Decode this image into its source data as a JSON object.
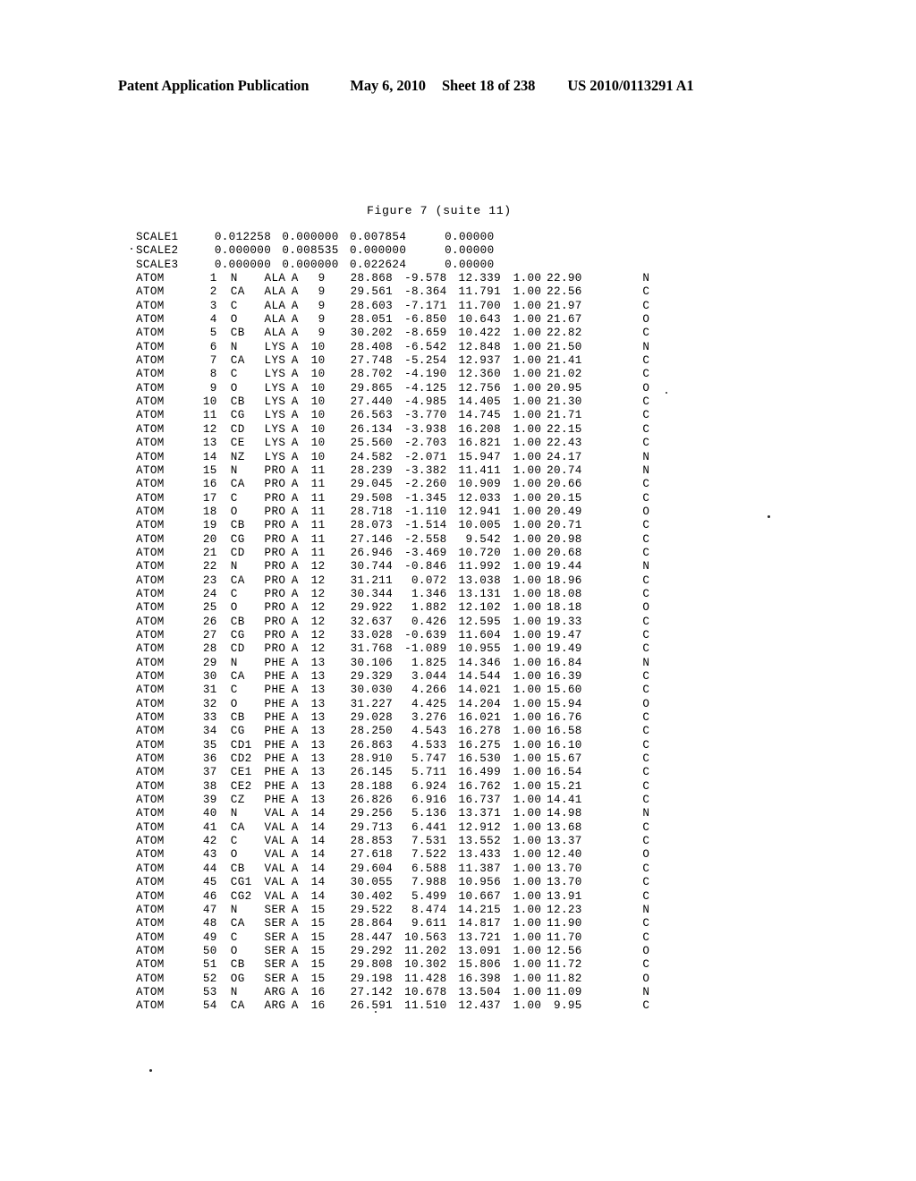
{
  "header": {
    "publication": "Patent Application Publication",
    "date": "May 6, 2010",
    "sheet": "Sheet 18 of 238",
    "patent_number": "US 2010/0113291 A1"
  },
  "figure": {
    "caption": "Figure 7 (suite 11)"
  },
  "listing": {
    "scale_rows": [
      {
        "label": "SCALE1",
        "s1": "0.012258",
        "s2": "0.000000",
        "s3": "0.007854",
        "s4": "0.00000"
      },
      {
        "label": "SCALE2",
        "s1": "0.000000",
        "s2": "0.008535",
        "s3": "0.000000",
        "s4": "0.00000"
      },
      {
        "label": "SCALE3",
        "s1": "0.000000",
        "s2": "0.000000",
        "s3": "0.022624",
        "s4": "0.00000"
      }
    ],
    "atom_rows": [
      {
        "record": "ATOM",
        "serial": "1",
        "atom": "N",
        "residue": "ALA",
        "chain": "A",
        "seq": "9",
        "x": "28.868",
        "y": "-9.578",
        "z": "12.339",
        "occupancy": "1.00",
        "bfactor": "22.90",
        "element": "N"
      },
      {
        "record": "ATOM",
        "serial": "2",
        "atom": "CA",
        "residue": "ALA",
        "chain": "A",
        "seq": "9",
        "x": "29.561",
        "y": "-8.364",
        "z": "11.791",
        "occupancy": "1.00",
        "bfactor": "22.56",
        "element": "C"
      },
      {
        "record": "ATOM",
        "serial": "3",
        "atom": "C",
        "residue": "ALA",
        "chain": "A",
        "seq": "9",
        "x": "28.603",
        "y": "-7.171",
        "z": "11.700",
        "occupancy": "1.00",
        "bfactor": "21.97",
        "element": "C"
      },
      {
        "record": "ATOM",
        "serial": "4",
        "atom": "O",
        "residue": "ALA",
        "chain": "A",
        "seq": "9",
        "x": "28.051",
        "y": "-6.850",
        "z": "10.643",
        "occupancy": "1.00",
        "bfactor": "21.67",
        "element": "O"
      },
      {
        "record": "ATOM",
        "serial": "5",
        "atom": "CB",
        "residue": "ALA",
        "chain": "A",
        "seq": "9",
        "x": "30.202",
        "y": "-8.659",
        "z": "10.422",
        "occupancy": "1.00",
        "bfactor": "22.82",
        "element": "C"
      },
      {
        "record": "ATOM",
        "serial": "6",
        "atom": "N",
        "residue": "LYS",
        "chain": "A",
        "seq": "10",
        "x": "28.408",
        "y": "-6.542",
        "z": "12.848",
        "occupancy": "1.00",
        "bfactor": "21.50",
        "element": "N"
      },
      {
        "record": "ATOM",
        "serial": "7",
        "atom": "CA",
        "residue": "LYS",
        "chain": "A",
        "seq": "10",
        "x": "27.748",
        "y": "-5.254",
        "z": "12.937",
        "occupancy": "1.00",
        "bfactor": "21.41",
        "element": "C"
      },
      {
        "record": "ATOM",
        "serial": "8",
        "atom": "C",
        "residue": "LYS",
        "chain": "A",
        "seq": "10",
        "x": "28.702",
        "y": "-4.190",
        "z": "12.360",
        "occupancy": "1.00",
        "bfactor": "21.02",
        "element": "C"
      },
      {
        "record": "ATOM",
        "serial": "9",
        "atom": "O",
        "residue": "LYS",
        "chain": "A",
        "seq": "10",
        "x": "29.865",
        "y": "-4.125",
        "z": "12.756",
        "occupancy": "1.00",
        "bfactor": "20.95",
        "element": "O"
      },
      {
        "record": "ATOM",
        "serial": "10",
        "atom": "CB",
        "residue": "LYS",
        "chain": "A",
        "seq": "10",
        "x": "27.440",
        "y": "-4.985",
        "z": "14.405",
        "occupancy": "1.00",
        "bfactor": "21.30",
        "element": "C"
      },
      {
        "record": "ATOM",
        "serial": "11",
        "atom": "CG",
        "residue": "LYS",
        "chain": "A",
        "seq": "10",
        "x": "26.563",
        "y": "-3.770",
        "z": "14.745",
        "occupancy": "1.00",
        "bfactor": "21.71",
        "element": "C"
      },
      {
        "record": "ATOM",
        "serial": "12",
        "atom": "CD",
        "residue": "LYS",
        "chain": "A",
        "seq": "10",
        "x": "26.134",
        "y": "-3.938",
        "z": "16.208",
        "occupancy": "1.00",
        "bfactor": "22.15",
        "element": "C"
      },
      {
        "record": "ATOM",
        "serial": "13",
        "atom": "CE",
        "residue": "LYS",
        "chain": "A",
        "seq": "10",
        "x": "25.560",
        "y": "-2.703",
        "z": "16.821",
        "occupancy": "1.00",
        "bfactor": "22.43",
        "element": "C"
      },
      {
        "record": "ATOM",
        "serial": "14",
        "atom": "NZ",
        "residue": "LYS",
        "chain": "A",
        "seq": "10",
        "x": "24.582",
        "y": "-2.071",
        "z": "15.947",
        "occupancy": "1.00",
        "bfactor": "24.17",
        "element": "N"
      },
      {
        "record": "ATOM",
        "serial": "15",
        "atom": "N",
        "residue": "PRO",
        "chain": "A",
        "seq": "11",
        "x": "28.239",
        "y": "-3.382",
        "z": "11.411",
        "occupancy": "1.00",
        "bfactor": "20.74",
        "element": "N"
      },
      {
        "record": "ATOM",
        "serial": "16",
        "atom": "CA",
        "residue": "PRO",
        "chain": "A",
        "seq": "11",
        "x": "29.045",
        "y": "-2.260",
        "z": "10.909",
        "occupancy": "1.00",
        "bfactor": "20.66",
        "element": "C"
      },
      {
        "record": "ATOM",
        "serial": "17",
        "atom": "C",
        "residue": "PRO",
        "chain": "A",
        "seq": "11",
        "x": "29.508",
        "y": "-1.345",
        "z": "12.033",
        "occupancy": "1.00",
        "bfactor": "20.15",
        "element": "C"
      },
      {
        "record": "ATOM",
        "serial": "18",
        "atom": "O",
        "residue": "PRO",
        "chain": "A",
        "seq": "11",
        "x": "28.718",
        "y": "-1.110",
        "z": "12.941",
        "occupancy": "1.00",
        "bfactor": "20.49",
        "element": "O"
      },
      {
        "record": "ATOM",
        "serial": "19",
        "atom": "CB",
        "residue": "PRO",
        "chain": "A",
        "seq": "11",
        "x": "28.073",
        "y": "-1.514",
        "z": "10.005",
        "occupancy": "1.00",
        "bfactor": "20.71",
        "element": "C"
      },
      {
        "record": "ATOM",
        "serial": "20",
        "atom": "CG",
        "residue": "PRO",
        "chain": "A",
        "seq": "11",
        "x": "27.146",
        "y": "-2.558",
        "z": "9.542",
        "occupancy": "1.00",
        "bfactor": "20.98",
        "element": "C"
      },
      {
        "record": "ATOM",
        "serial": "21",
        "atom": "CD",
        "residue": "PRO",
        "chain": "A",
        "seq": "11",
        "x": "26.946",
        "y": "-3.469",
        "z": "10.720",
        "occupancy": "1.00",
        "bfactor": "20.68",
        "element": "C"
      },
      {
        "record": "ATOM",
        "serial": "22",
        "atom": "N",
        "residue": "PRO",
        "chain": "A",
        "seq": "12",
        "x": "30.744",
        "y": "-0.846",
        "z": "11.992",
        "occupancy": "1.00",
        "bfactor": "19.44",
        "element": "N"
      },
      {
        "record": "ATOM",
        "serial": "23",
        "atom": "CA",
        "residue": "PRO",
        "chain": "A",
        "seq": "12",
        "x": "31.211",
        "y": "0.072",
        "z": "13.038",
        "occupancy": "1.00",
        "bfactor": "18.96",
        "element": "C"
      },
      {
        "record": "ATOM",
        "serial": "24",
        "atom": "C",
        "residue": "PRO",
        "chain": "A",
        "seq": "12",
        "x": "30.344",
        "y": "1.346",
        "z": "13.131",
        "occupancy": "1.00",
        "bfactor": "18.08",
        "element": "C"
      },
      {
        "record": "ATOM",
        "serial": "25",
        "atom": "O",
        "residue": "PRO",
        "chain": "A",
        "seq": "12",
        "x": "29.922",
        "y": "1.882",
        "z": "12.102",
        "occupancy": "1.00",
        "bfactor": "18.18",
        "element": "O"
      },
      {
        "record": "ATOM",
        "serial": "26",
        "atom": "CB",
        "residue": "PRO",
        "chain": "A",
        "seq": "12",
        "x": "32.637",
        "y": "0.426",
        "z": "12.595",
        "occupancy": "1.00",
        "bfactor": "19.33",
        "element": "C"
      },
      {
        "record": "ATOM",
        "serial": "27",
        "atom": "CG",
        "residue": "PRO",
        "chain": "A",
        "seq": "12",
        "x": "33.028",
        "y": "-0.639",
        "z": "11.604",
        "occupancy": "1.00",
        "bfactor": "19.47",
        "element": "C"
      },
      {
        "record": "ATOM",
        "serial": "28",
        "atom": "CD",
        "residue": "PRO",
        "chain": "A",
        "seq": "12",
        "x": "31.768",
        "y": "-1.089",
        "z": "10.955",
        "occupancy": "1.00",
        "bfactor": "19.49",
        "element": "C"
      },
      {
        "record": "ATOM",
        "serial": "29",
        "atom": "N",
        "residue": "PHE",
        "chain": "A",
        "seq": "13",
        "x": "30.106",
        "y": "1.825",
        "z": "14.346",
        "occupancy": "1.00",
        "bfactor": "16.84",
        "element": "N"
      },
      {
        "record": "ATOM",
        "serial": "30",
        "atom": "CA",
        "residue": "PHE",
        "chain": "A",
        "seq": "13",
        "x": "29.329",
        "y": "3.044",
        "z": "14.544",
        "occupancy": "1.00",
        "bfactor": "16.39",
        "element": "C"
      },
      {
        "record": "ATOM",
        "serial": "31",
        "atom": "C",
        "residue": "PHE",
        "chain": "A",
        "seq": "13",
        "x": "30.030",
        "y": "4.266",
        "z": "14.021",
        "occupancy": "1.00",
        "bfactor": "15.60",
        "element": "C"
      },
      {
        "record": "ATOM",
        "serial": "32",
        "atom": "O",
        "residue": "PHE",
        "chain": "A",
        "seq": "13",
        "x": "31.227",
        "y": "4.425",
        "z": "14.204",
        "occupancy": "1.00",
        "bfactor": "15.94",
        "element": "O"
      },
      {
        "record": "ATOM",
        "serial": "33",
        "atom": "CB",
        "residue": "PHE",
        "chain": "A",
        "seq": "13",
        "x": "29.028",
        "y": "3.276",
        "z": "16.021",
        "occupancy": "1.00",
        "bfactor": "16.76",
        "element": "C"
      },
      {
        "record": "ATOM",
        "serial": "34",
        "atom": "CG",
        "residue": "PHE",
        "chain": "A",
        "seq": "13",
        "x": "28.250",
        "y": "4.543",
        "z": "16.278",
        "occupancy": "1.00",
        "bfactor": "16.58",
        "element": "C"
      },
      {
        "record": "ATOM",
        "serial": "35",
        "atom": "CD1",
        "residue": "PHE",
        "chain": "A",
        "seq": "13",
        "x": "26.863",
        "y": "4.533",
        "z": "16.275",
        "occupancy": "1.00",
        "bfactor": "16.10",
        "element": "C"
      },
      {
        "record": "ATOM",
        "serial": "36",
        "atom": "CD2",
        "residue": "PHE",
        "chain": "A",
        "seq": "13",
        "x": "28.910",
        "y": "5.747",
        "z": "16.530",
        "occupancy": "1.00",
        "bfactor": "15.67",
        "element": "C"
      },
      {
        "record": "ATOM",
        "serial": "37",
        "atom": "CE1",
        "residue": "PHE",
        "chain": "A",
        "seq": "13",
        "x": "26.145",
        "y": "5.711",
        "z": "16.499",
        "occupancy": "1.00",
        "bfactor": "16.54",
        "element": "C"
      },
      {
        "record": "ATOM",
        "serial": "38",
        "atom": "CE2",
        "residue": "PHE",
        "chain": "A",
        "seq": "13",
        "x": "28.188",
        "y": "6.924",
        "z": "16.762",
        "occupancy": "1.00",
        "bfactor": "15.21",
        "element": "C"
      },
      {
        "record": "ATOM",
        "serial": "39",
        "atom": "CZ",
        "residue": "PHE",
        "chain": "A",
        "seq": "13",
        "x": "26.826",
        "y": "6.916",
        "z": "16.737",
        "occupancy": "1.00",
        "bfactor": "14.41",
        "element": "C"
      },
      {
        "record": "ATOM",
        "serial": "40",
        "atom": "N",
        "residue": "VAL",
        "chain": "A",
        "seq": "14",
        "x": "29.256",
        "y": "5.136",
        "z": "13.371",
        "occupancy": "1.00",
        "bfactor": "14.98",
        "element": "N"
      },
      {
        "record": "ATOM",
        "serial": "41",
        "atom": "CA",
        "residue": "VAL",
        "chain": "A",
        "seq": "14",
        "x": "29.713",
        "y": "6.441",
        "z": "12.912",
        "occupancy": "1.00",
        "bfactor": "13.68",
        "element": "C"
      },
      {
        "record": "ATOM",
        "serial": "42",
        "atom": "C",
        "residue": "VAL",
        "chain": "A",
        "seq": "14",
        "x": "28.853",
        "y": "7.531",
        "z": "13.552",
        "occupancy": "1.00",
        "bfactor": "13.37",
        "element": "C"
      },
      {
        "record": "ATOM",
        "serial": "43",
        "atom": "O",
        "residue": "VAL",
        "chain": "A",
        "seq": "14",
        "x": "27.618",
        "y": "7.522",
        "z": "13.433",
        "occupancy": "1.00",
        "bfactor": "12.40",
        "element": "O"
      },
      {
        "record": "ATOM",
        "serial": "44",
        "atom": "CB",
        "residue": "VAL",
        "chain": "A",
        "seq": "14",
        "x": "29.604",
        "y": "6.588",
        "z": "11.387",
        "occupancy": "1.00",
        "bfactor": "13.70",
        "element": "C"
      },
      {
        "record": "ATOM",
        "serial": "45",
        "atom": "CG1",
        "residue": "VAL",
        "chain": "A",
        "seq": "14",
        "x": "30.055",
        "y": "7.988",
        "z": "10.956",
        "occupancy": "1.00",
        "bfactor": "13.70",
        "element": "C"
      },
      {
        "record": "ATOM",
        "serial": "46",
        "atom": "CG2",
        "residue": "VAL",
        "chain": "A",
        "seq": "14",
        "x": "30.402",
        "y": "5.499",
        "z": "10.667",
        "occupancy": "1.00",
        "bfactor": "13.91",
        "element": "C"
      },
      {
        "record": "ATOM",
        "serial": "47",
        "atom": "N",
        "residue": "SER",
        "chain": "A",
        "seq": "15",
        "x": "29.522",
        "y": "8.474",
        "z": "14.215",
        "occupancy": "1.00",
        "bfactor": "12.23",
        "element": "N"
      },
      {
        "record": "ATOM",
        "serial": "48",
        "atom": "CA",
        "residue": "SER",
        "chain": "A",
        "seq": "15",
        "x": "28.864",
        "y": "9.611",
        "z": "14.817",
        "occupancy": "1.00",
        "bfactor": "11.90",
        "element": "C"
      },
      {
        "record": "ATOM",
        "serial": "49",
        "atom": "C",
        "residue": "SER",
        "chain": "A",
        "seq": "15",
        "x": "28.447",
        "y": "10.563",
        "z": "13.721",
        "occupancy": "1.00",
        "bfactor": "11.70",
        "element": "C"
      },
      {
        "record": "ATOM",
        "serial": "50",
        "atom": "O",
        "residue": "SER",
        "chain": "A",
        "seq": "15",
        "x": "29.292",
        "y": "11.202",
        "z": "13.091",
        "occupancy": "1.00",
        "bfactor": "12.56",
        "element": "O"
      },
      {
        "record": "ATOM",
        "serial": "51",
        "atom": "CB",
        "residue": "SER",
        "chain": "A",
        "seq": "15",
        "x": "29.808",
        "y": "10.302",
        "z": "15.806",
        "occupancy": "1.00",
        "bfactor": "11.72",
        "element": "C"
      },
      {
        "record": "ATOM",
        "serial": "52",
        "atom": "OG",
        "residue": "SER",
        "chain": "A",
        "seq": "15",
        "x": "29.198",
        "y": "11.428",
        "z": "16.398",
        "occupancy": "1.00",
        "bfactor": "11.82",
        "element": "O"
      },
      {
        "record": "ATOM",
        "serial": "53",
        "atom": "N",
        "residue": "ARG",
        "chain": "A",
        "seq": "16",
        "x": "27.142",
        "y": "10.678",
        "z": "13.504",
        "occupancy": "1.00",
        "bfactor": "11.09",
        "element": "N"
      },
      {
        "record": "ATOM",
        "serial": "54",
        "atom": "CA",
        "residue": "ARG",
        "chain": "A",
        "seq": "16",
        "x": "26.591",
        "y": "11.510",
        "z": "12.437",
        "occupancy": "1.00",
        "bfactor": "9.95",
        "element": "C"
      }
    ]
  }
}
